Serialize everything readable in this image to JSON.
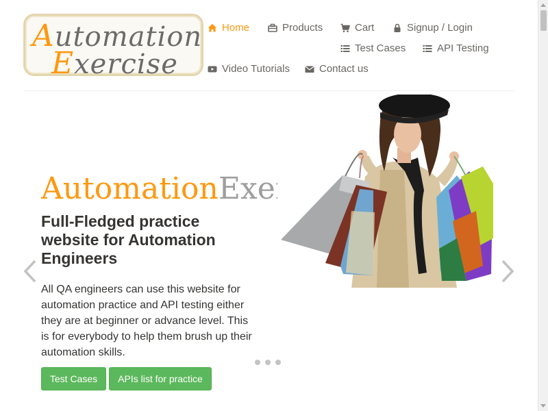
{
  "logo": {
    "line1_cap": "A",
    "line1_rest": "utomation",
    "line2_cap": "E",
    "line2_rest": "xercise"
  },
  "nav": {
    "home": "Home",
    "products": "Products",
    "cart": "Cart",
    "signup_login": "Signup / Login",
    "test_cases": "Test Cases",
    "api_testing": "API Testing",
    "video_tutorials": "Video Tutorials",
    "contact_us": "Contact us",
    "active_item": "home",
    "icons": {
      "home": "home-icon",
      "products": "briefcase-icon",
      "cart": "shopping-cart-icon",
      "signup_login": "lock-icon",
      "test_cases": "list-icon",
      "api_testing": "list-icon",
      "video_tutorials": "youtube-play-icon",
      "contact_us": "envelope-icon"
    }
  },
  "slider": {
    "title_part1": "Automation",
    "title_part2": "Exercise",
    "heading": "Full-Fledged practice website for Automation Engineers",
    "description": "All QA engineers can use this website for automation practice and API testing either they are at beginner or advance level. This is for everybody to help them brush up their automation skills.",
    "buttons": {
      "test_cases": "Test Cases",
      "apis_list": "APIs list for practice"
    },
    "indicator_count": 3,
    "controls": {
      "prev_icon": "chevron-left-icon",
      "next_icon": "chevron-right-icon"
    }
  },
  "colors": {
    "accent": "#fe980f",
    "nav_text": "#696763",
    "heading_text": "#363432",
    "button_green": "#5cb85c",
    "title_grey": "#9e9e9e"
  }
}
